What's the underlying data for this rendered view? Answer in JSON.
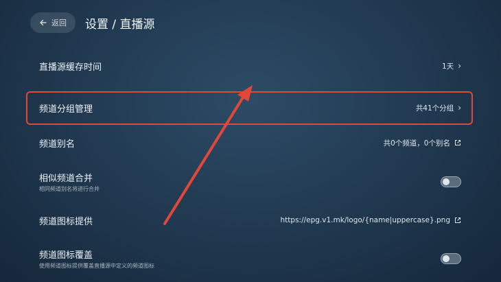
{
  "header": {
    "back_label": "返回",
    "title": "设置 / 直播源"
  },
  "rows": [
    {
      "label": "直播源缓存时间",
      "value": "1天"
    },
    {
      "label": "频道分组管理",
      "value": "共41个分组"
    },
    {
      "label": "频道别名",
      "value": "共0个频道，0个别名"
    },
    {
      "label": "相似频道合并",
      "sub": "相同频道别名将进行合并"
    },
    {
      "label": "频道图标提供",
      "value": "https://epg.v1.mk/logo/{name|uppercase}.png"
    },
    {
      "label": "频道图标覆盖",
      "sub": "使用频道图标提供覆盖直播源中定义的频道图标"
    }
  ],
  "colors": {
    "annotation": "#e2473a",
    "toggle_off": "#5b6d7c"
  }
}
